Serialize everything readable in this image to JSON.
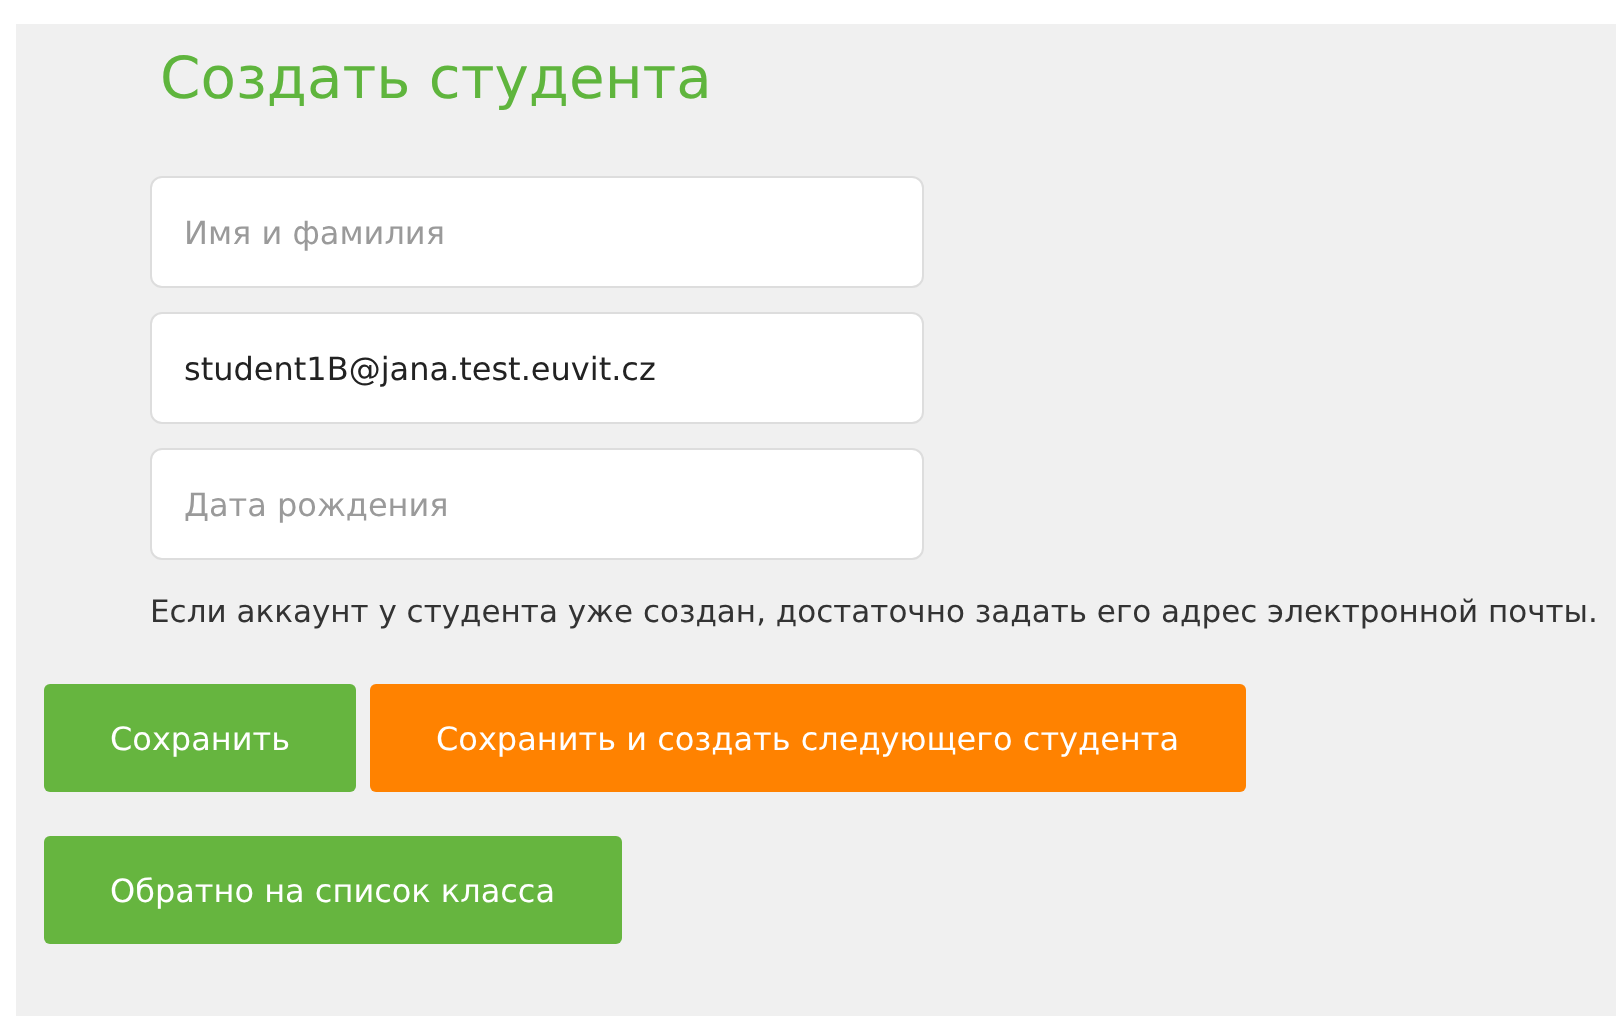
{
  "title": "Создать студента",
  "fields": [
    {
      "placeholder": "Имя и фамилия"
    },
    {
      "value": "student1B@jana.test.euvit.cz"
    },
    {
      "placeholder": "Дата рождения"
    }
  ],
  "hint": "Если аккаунт у студента уже создан, достаточно задать его адрес электронной почты.",
  "buttons": [
    {
      "label": "Сохранить",
      "kind": "primary"
    },
    {
      "label": "Сохранить и создать следующего студента",
      "kind": "accent"
    },
    {
      "label": "Обратно на список класса",
      "kind": "primary"
    }
  ]
}
